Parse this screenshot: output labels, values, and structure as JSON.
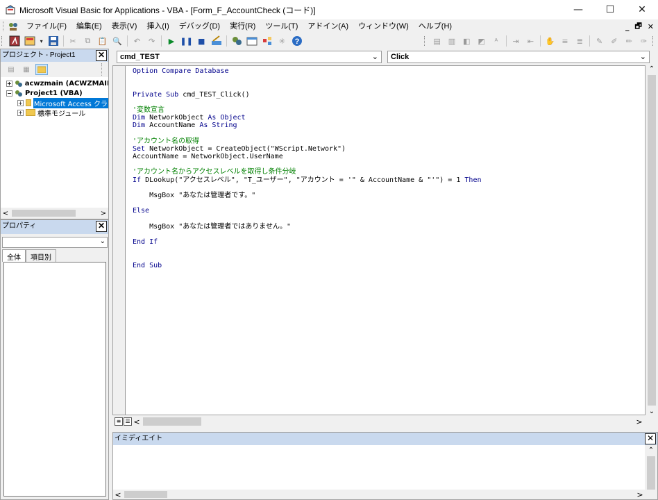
{
  "window": {
    "title": "Microsoft Visual Basic for Applications - VBA - [Form_F_AccountCheck (コード)]",
    "minimize": "—",
    "maximize": "☐",
    "close": "✕"
  },
  "menu": {
    "items": [
      "ファイル(F)",
      "編集(E)",
      "表示(V)",
      "挿入(I)",
      "デバッグ(D)",
      "実行(R)",
      "ツール(T)",
      "アドイン(A)",
      "ウィンドウ(W)",
      "ヘルプ(H)"
    ],
    "mdi_min": "_",
    "mdi_restore": "🗗",
    "mdi_close": "✕"
  },
  "project_pane": {
    "title": "プロジェクト - Project1",
    "tree": [
      {
        "label": "acwzmain (ACWZMAIN",
        "level": 0,
        "expander": "+",
        "bold": true
      },
      {
        "label": "Project1 (VBA)",
        "level": 0,
        "expander": "−",
        "bold": true
      },
      {
        "label": "Microsoft Access クラ",
        "level": 1,
        "expander": "+",
        "selected": true
      },
      {
        "label": "標準モジュール",
        "level": 1,
        "expander": "+"
      }
    ]
  },
  "properties_pane": {
    "title": "プロパティ",
    "tabs": [
      "全体",
      "項目別"
    ]
  },
  "code_window": {
    "object_combo": "cmd_TEST",
    "procedure_combo": "Click",
    "lines": [
      [
        {
          "t": "Option Compare Database",
          "c": "kw"
        }
      ],
      [],
      [],
      [
        {
          "t": "Private Sub",
          "c": "kw"
        },
        {
          "t": " cmd_TEST_Click()"
        }
      ],
      [],
      [
        {
          "t": "'変数宣言",
          "c": "cm"
        }
      ],
      [
        {
          "t": "Dim",
          "c": "kw"
        },
        {
          "t": " NetworkObject "
        },
        {
          "t": "As Object",
          "c": "kw"
        }
      ],
      [
        {
          "t": "Dim",
          "c": "kw"
        },
        {
          "t": " AccountName "
        },
        {
          "t": "As String",
          "c": "kw"
        }
      ],
      [],
      [
        {
          "t": "'アカウント名の取得",
          "c": "cm"
        }
      ],
      [
        {
          "t": "Set",
          "c": "kw"
        },
        {
          "t": " NetworkObject = CreateObject(\"WScript.Network\")"
        }
      ],
      [
        {
          "t": "AccountName = NetworkObject.UserName"
        }
      ],
      [],
      [
        {
          "t": "'アカウント名からアクセスレベルを取得し条件分岐",
          "c": "cm"
        }
      ],
      [
        {
          "t": "If",
          "c": "kw"
        },
        {
          "t": " DLookup(\"アクセスレベル\", \"T_ユーザー\", \"アカウント = '\" & AccountName & \"'\") = 1 "
        },
        {
          "t": "Then",
          "c": "kw"
        }
      ],
      [],
      [
        {
          "t": "    MsgBox \"あなたは管理者です。\""
        }
      ],
      [],
      [
        {
          "t": "Else",
          "c": "kw"
        }
      ],
      [],
      [
        {
          "t": "    MsgBox \"あなたは管理者ではありません。\""
        }
      ],
      [],
      [
        {
          "t": "End If",
          "c": "kw"
        }
      ],
      [],
      [],
      [
        {
          "t": "End Sub",
          "c": "kw"
        }
      ]
    ]
  },
  "immediate_pane": {
    "title": "イミディエイト"
  }
}
